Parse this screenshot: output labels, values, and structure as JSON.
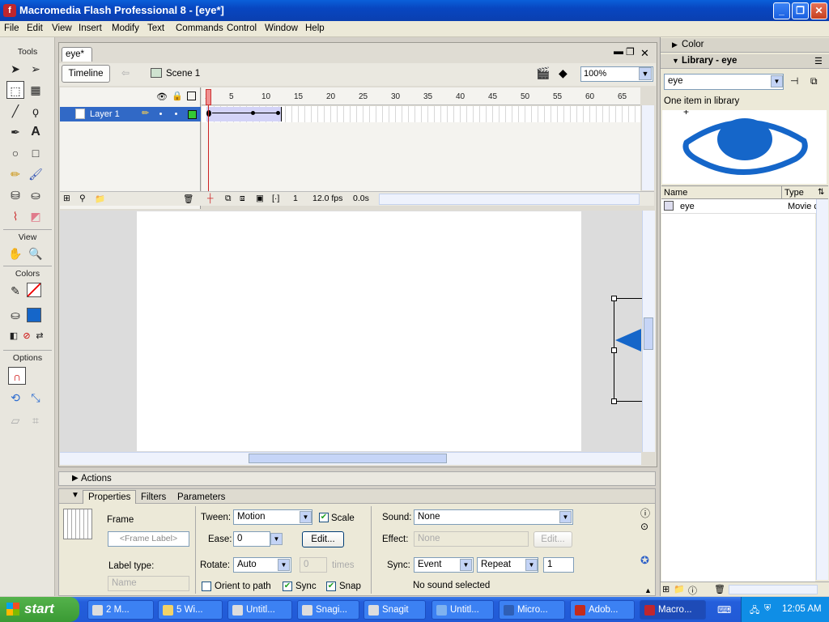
{
  "window": {
    "title": "Macromedia Flash Professional 8 - [eye*]",
    "app_icon": "flash-icon",
    "controls": [
      "_",
      "❐",
      "✕"
    ]
  },
  "menubar": [
    "File",
    "Edit",
    "View",
    "Insert",
    "Modify",
    "Text",
    "Commands",
    "Control",
    "Window",
    "Help"
  ],
  "tools": {
    "header": "Tools",
    "view_header": "View",
    "colors_header": "Colors",
    "options_header": "Options"
  },
  "document": {
    "tab": "eye*",
    "timeline_button": "Timeline",
    "scene_label": "Scene 1",
    "zoom": "100%"
  },
  "timeline": {
    "layer_name": "Layer 1",
    "frame_numbers": [
      "1",
      "5",
      "10",
      "15",
      "20",
      "25",
      "30",
      "35",
      "40",
      "45",
      "50",
      "55",
      "60",
      "65"
    ],
    "current_frame": "1",
    "frame_rate": "12.0 fps",
    "elapsed": "0.0s"
  },
  "actions_panel": {
    "title": "Actions"
  },
  "properties": {
    "tabs": [
      "Properties",
      "Filters",
      "Parameters"
    ],
    "type_label": "Frame",
    "frame_label_placeholder": "<Frame Label>",
    "label_type_label": "Label type:",
    "label_type_value": "Name",
    "tween_label": "Tween:",
    "tween_value": "Motion",
    "scale_label": "Scale",
    "ease_label": "Ease:",
    "ease_value": "0",
    "edit_button": "Edit...",
    "rotate_label": "Rotate:",
    "rotate_value": "Auto",
    "rotate_times_value": "0",
    "times_label": "times",
    "orient_label": "Orient to path",
    "sync_label": "Sync",
    "snap_label": "Snap",
    "sound_label": "Sound:",
    "sound_value": "None",
    "effect_label": "Effect:",
    "effect_value": "None",
    "effect_edit_button": "Edit...",
    "sync_sound_label": "Sync:",
    "sync_sound_value": "Event",
    "repeat_value": "Repeat",
    "repeat_count": "1",
    "sound_status": "No sound selected"
  },
  "right_panels": {
    "color_title": "Color",
    "library_title": "Library - eye",
    "library_select": "eye",
    "library_count": "One item in library",
    "col_name": "Name",
    "col_type": "Type",
    "item_name": "eye",
    "item_type": "Movie c"
  },
  "taskbar": {
    "start": "start",
    "tasks": [
      {
        "label": "2 M...",
        "icon": "messenger-icon"
      },
      {
        "label": "5 Wi...",
        "icon": "folder-icon"
      },
      {
        "label": "Untitl...",
        "icon": "snagit-editor-icon"
      },
      {
        "label": "Snagi...",
        "icon": "snagit-icon"
      },
      {
        "label": "Snagit",
        "icon": "snagit-capture-icon"
      },
      {
        "label": "Untitl...",
        "icon": "ie-icon"
      },
      {
        "label": "Micro...",
        "icon": "word-icon"
      },
      {
        "label": "Adob...",
        "icon": "acrobat-icon"
      },
      {
        "label": "Macro...",
        "icon": "flash-icon"
      }
    ],
    "clock": "12:05 AM"
  },
  "colors": {
    "accent_blue": "#0a5fd9",
    "eye_blue": "#1566c9",
    "selection_blue": "#3169c6",
    "fill_color": "#1566c9"
  }
}
